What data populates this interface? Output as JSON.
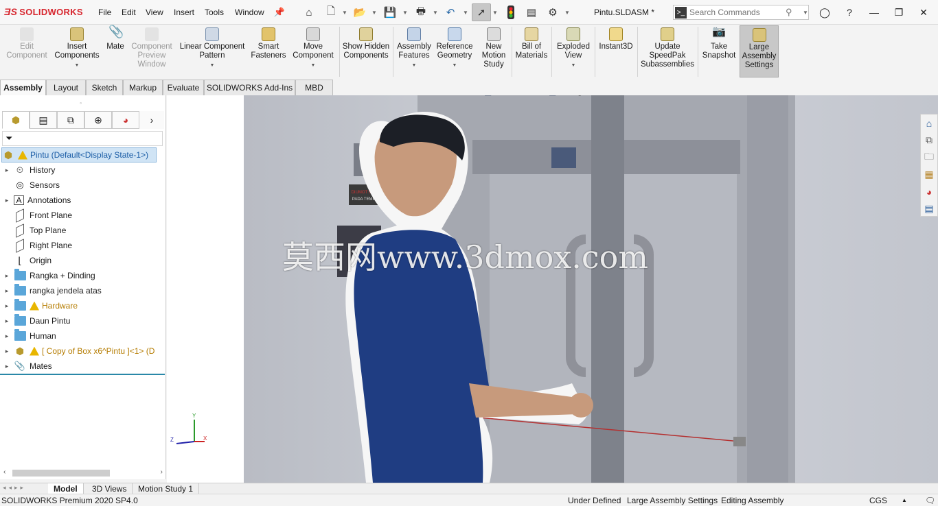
{
  "app": {
    "logo_text": "SOLIDWORKS",
    "document_title": "Pintu.SLDASM *"
  },
  "menu": [
    "File",
    "Edit",
    "View",
    "Insert",
    "Tools",
    "Window"
  ],
  "search": {
    "placeholder": "Search Commands"
  },
  "commands": [
    {
      "label": "Edit Component",
      "disabled": true
    },
    {
      "label": "Insert Components",
      "disabled": false
    },
    {
      "label": "Mate",
      "disabled": false
    },
    {
      "label": "Component Preview Window",
      "disabled": true
    },
    {
      "label": "Linear Component Pattern",
      "disabled": false
    },
    {
      "label": "Smart Fasteners",
      "disabled": false
    },
    {
      "label": "Move Component",
      "disabled": false
    },
    {
      "label": "Show Hidden Components",
      "disabled": false
    },
    {
      "label": "Assembly Features",
      "disabled": false
    },
    {
      "label": "Reference Geometry",
      "disabled": false
    },
    {
      "label": "New Motion Study",
      "disabled": false
    },
    {
      "label": "Bill of Materials",
      "disabled": false
    },
    {
      "label": "Exploded View",
      "disabled": false
    },
    {
      "label": "Instant3D",
      "disabled": false
    },
    {
      "label": "Update SpeedPak Subassemblies",
      "disabled": false
    },
    {
      "label": "Take Snapshot",
      "disabled": false
    },
    {
      "label": "Large Assembly Settings",
      "disabled": false
    }
  ],
  "tabs": [
    "Assembly",
    "Layout",
    "Sketch",
    "Markup",
    "Evaluate",
    "SOLIDWORKS Add-Ins",
    "MBD"
  ],
  "tree": {
    "root": "Pintu  (Default<Display State-1>)",
    "items": [
      "History",
      "Sensors",
      "Annotations",
      "Front Plane",
      "Top Plane",
      "Right Plane",
      "Origin",
      "Rangka + Dinding",
      "rangka jendela atas",
      "Hardware",
      "Daun Pintu",
      "Human",
      "[ Copy of Box x6^Pintu ]<1> (D",
      "Mates"
    ]
  },
  "viewport": {
    "watermark": "莫西网www.3dmox.com",
    "sign_text_1": "DIUMOT LAH RAYU",
    "sign_text_2": "PADA TEMPATNYA"
  },
  "bottom_tabs": [
    "Model",
    "3D Views",
    "Motion Study 1"
  ],
  "status": {
    "version": "SOLIDWORKS Premium 2020 SP4.0",
    "state": "Under Defined",
    "large_assembly": "Large Assembly Settings",
    "editing": "Editing Assembly",
    "units": "CGS"
  },
  "colors": {
    "accent_red": "#d7262e",
    "tree_highlight": "#d0e4f5",
    "warning": "#e8b600",
    "folder": "#5aa6d9"
  }
}
